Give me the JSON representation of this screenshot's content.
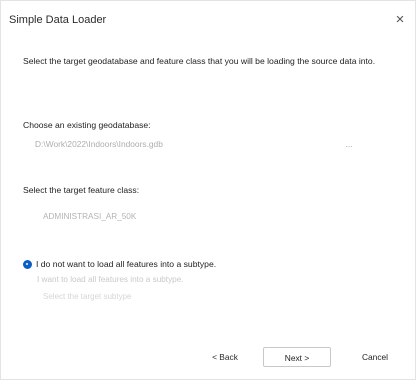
{
  "window": {
    "title": "Simple Data Loader",
    "close_glyph": "×"
  },
  "page": {
    "instruction": "Select the target geodatabase and feature class that you will be loading the source data into.",
    "geodatabase_label": "Choose an existing geodatabase:",
    "geodatabase_value": "D:\\Work\\2022\\Indoors\\Indoors.gdb",
    "geodatabase_browse_label": "...",
    "feature_class_label": "Select the target feature class:",
    "feature_class_value": "ADMINISTRASI_AR_50K",
    "no_subtype_option_label": "I do not want to load all features into a subtype.",
    "subtype_option_label": "I want to load all features into a subtype.",
    "subtype_select_placeholder": "Select the target subtype"
  },
  "footer": {
    "back_label": "< Back",
    "next_label": "Next >",
    "cancel_label": "Cancel"
  },
  "colors": {
    "accent": "#0a5fc4",
    "disabled_text": "#b3b3b3",
    "background": "#ffffff"
  }
}
